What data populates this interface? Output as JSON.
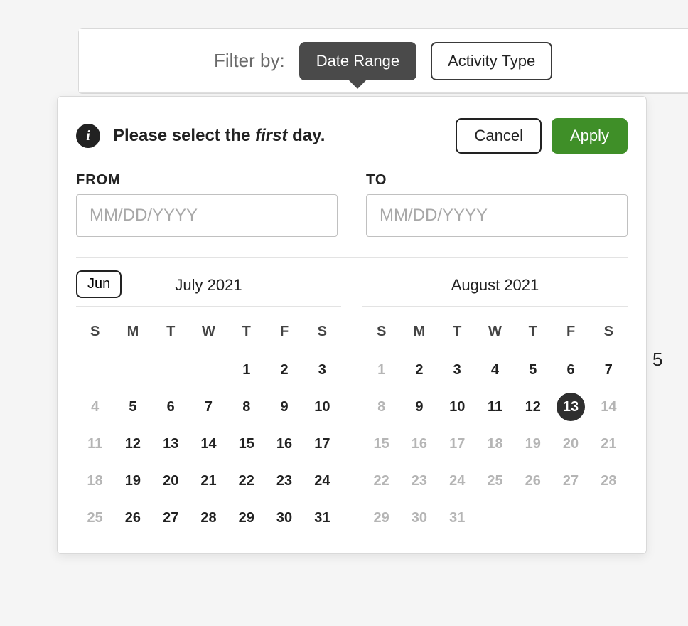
{
  "filter": {
    "label": "Filter by:",
    "tabs": [
      {
        "label": "Date Range",
        "active": true
      },
      {
        "label": "Activity Type",
        "active": false
      }
    ]
  },
  "popover": {
    "info_prefix": "Please select the ",
    "info_emph": "first",
    "info_suffix": " day.",
    "cancel_label": "Cancel",
    "apply_label": "Apply",
    "from_label": "FROM",
    "to_label": "TO",
    "from_value": "",
    "to_value": "",
    "placeholder": "MM/DD/YYYY",
    "prev_month_label": "Jun",
    "weekday_headers": [
      "S",
      "M",
      "T",
      "W",
      "T",
      "F",
      "S"
    ],
    "months": [
      {
        "title": "July 2021",
        "show_prev": true,
        "weeks": [
          [
            null,
            null,
            null,
            null,
            {
              "d": 1
            },
            {
              "d": 2
            },
            {
              "d": 3
            }
          ],
          [
            {
              "d": 4,
              "muted": true
            },
            {
              "d": 5
            },
            {
              "d": 6
            },
            {
              "d": 7
            },
            {
              "d": 8
            },
            {
              "d": 9
            },
            {
              "d": 10
            }
          ],
          [
            {
              "d": 11,
              "muted": true
            },
            {
              "d": 12
            },
            {
              "d": 13
            },
            {
              "d": 14
            },
            {
              "d": 15
            },
            {
              "d": 16
            },
            {
              "d": 17
            }
          ],
          [
            {
              "d": 18,
              "muted": true
            },
            {
              "d": 19
            },
            {
              "d": 20
            },
            {
              "d": 21
            },
            {
              "d": 22
            },
            {
              "d": 23
            },
            {
              "d": 24
            }
          ],
          [
            {
              "d": 25,
              "muted": true
            },
            {
              "d": 26
            },
            {
              "d": 27
            },
            {
              "d": 28
            },
            {
              "d": 29
            },
            {
              "d": 30
            },
            {
              "d": 31
            }
          ]
        ]
      },
      {
        "title": "August 2021",
        "show_prev": false,
        "weeks": [
          [
            {
              "d": 1,
              "muted": true
            },
            {
              "d": 2
            },
            {
              "d": 3
            },
            {
              "d": 4
            },
            {
              "d": 5
            },
            {
              "d": 6
            },
            {
              "d": 7
            }
          ],
          [
            {
              "d": 8,
              "muted": true
            },
            {
              "d": 9
            },
            {
              "d": 10
            },
            {
              "d": 11
            },
            {
              "d": 12
            },
            {
              "d": 13,
              "selected": true
            },
            {
              "d": 14,
              "muted": true
            }
          ],
          [
            {
              "d": 15,
              "muted": true
            },
            {
              "d": 16,
              "muted": true
            },
            {
              "d": 17,
              "muted": true
            },
            {
              "d": 18,
              "muted": true
            },
            {
              "d": 19,
              "muted": true
            },
            {
              "d": 20,
              "muted": true
            },
            {
              "d": 21,
              "muted": true
            }
          ],
          [
            {
              "d": 22,
              "muted": true
            },
            {
              "d": 23,
              "muted": true
            },
            {
              "d": 24,
              "muted": true
            },
            {
              "d": 25,
              "muted": true
            },
            {
              "d": 26,
              "muted": true
            },
            {
              "d": 27,
              "muted": true
            },
            {
              "d": 28,
              "muted": true
            }
          ],
          [
            {
              "d": 29,
              "muted": true
            },
            {
              "d": 30,
              "muted": true
            },
            {
              "d": 31,
              "muted": true
            },
            null,
            null,
            null,
            null
          ]
        ]
      }
    ]
  },
  "bg_fragment": "5"
}
